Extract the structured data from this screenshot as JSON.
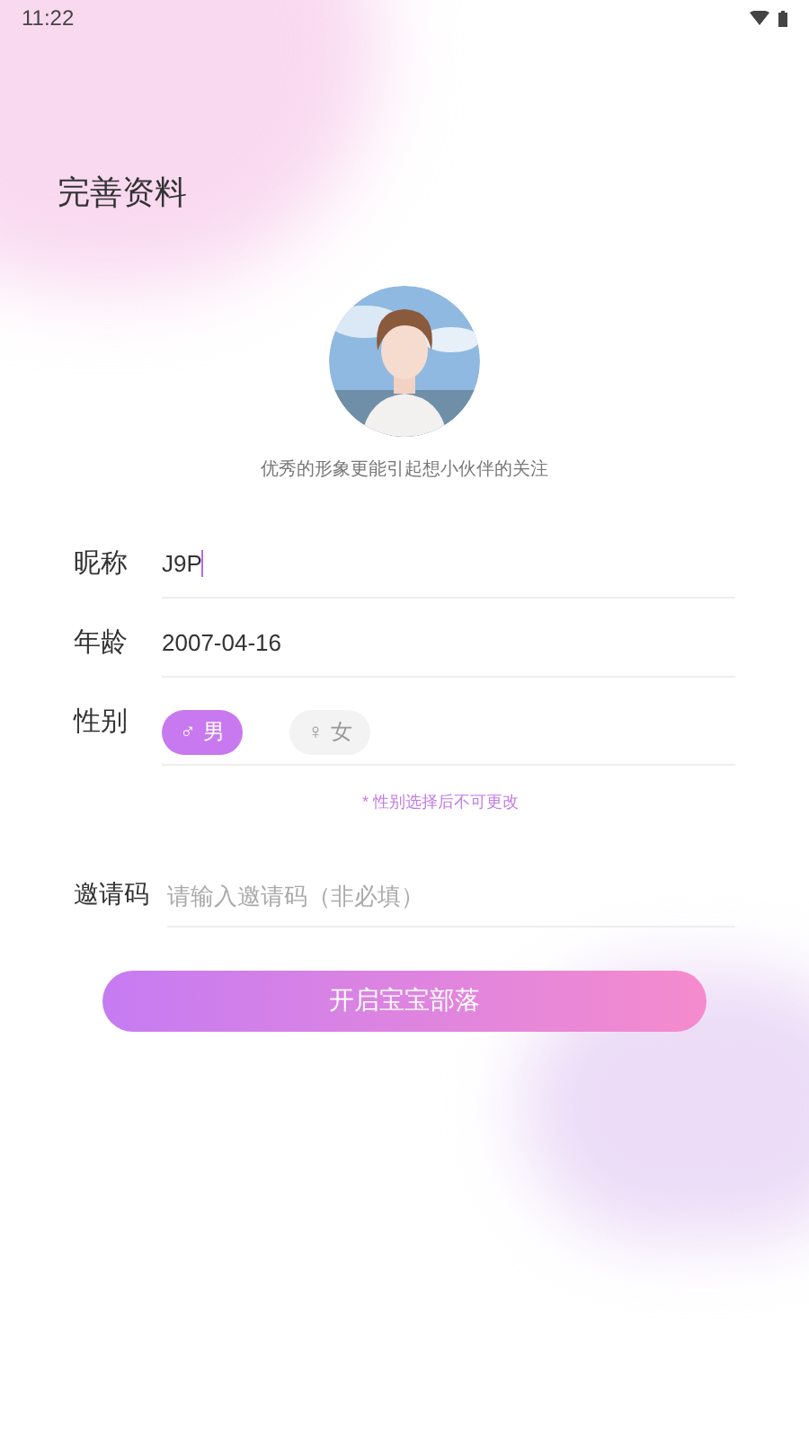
{
  "status_bar": {
    "time": "11:22"
  },
  "title": "完善资料",
  "avatar": {
    "kind": "picture",
    "caption": "优秀的形象更能引起想小伙伴的关注"
  },
  "form": {
    "nickname": {
      "label": "昵称",
      "value": "J9P",
      "focused": true
    },
    "age": {
      "label": "年龄",
      "value": "2007-04-16"
    },
    "gender": {
      "label": "性别",
      "options": [
        {
          "symbol": "♂",
          "label": "男",
          "selected": true
        },
        {
          "symbol": "♀",
          "label": "女",
          "selected": false
        }
      ],
      "note": "* 性别选择后不可更改"
    },
    "invite": {
      "label": "邀请码",
      "placeholder": "请输入邀请码（非必填）"
    }
  },
  "submit": "开启宝宝部落"
}
